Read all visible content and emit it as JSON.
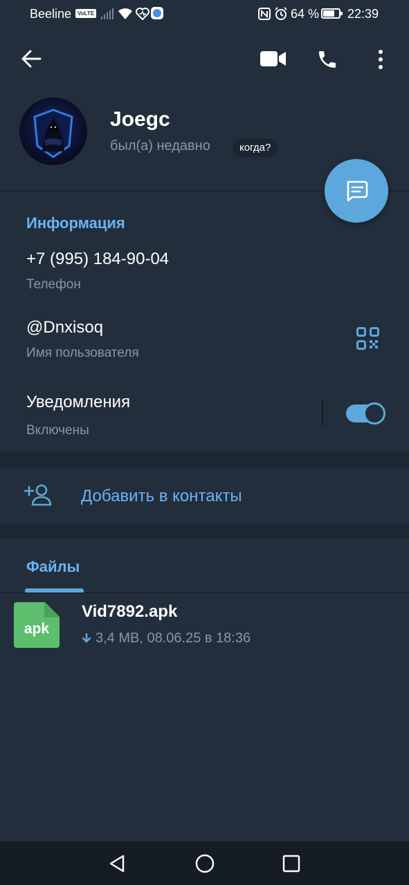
{
  "status_bar": {
    "carrier": "Beeline",
    "volte": "VoLTE",
    "battery": "64 %",
    "time": "22:39"
  },
  "header": {
    "name": "Joegc",
    "status": "был(а) недавно",
    "when_pill": "когда?"
  },
  "info": {
    "title": "Информация",
    "phone": "+7 (995) 184-90-04",
    "phone_label": "Телефон",
    "username": "@Dnxisoq",
    "username_label": "Имя пользователя",
    "notifications": "Уведомления",
    "notifications_state": "Включены",
    "notifications_on": true
  },
  "add_contact": {
    "label": "Добавить в контакты"
  },
  "files": {
    "tab": "Файлы",
    "items": [
      {
        "ext": "apk",
        "name": "Vid7892.apk",
        "meta": "3,4 MB, 08.06.25 в 18:36"
      }
    ]
  },
  "colors": {
    "accent": "#6ab3f3",
    "fab": "#5ca8dc",
    "background": "#1d2733",
    "panel": "#232e3c",
    "file_icon": "#5dbf6d"
  },
  "icons": [
    "back-arrow-icon",
    "video-call-icon",
    "phone-call-icon",
    "more-vert-icon",
    "message-icon",
    "qr-code-icon",
    "add-user-icon",
    "download-arrow-icon",
    "nav-back-icon",
    "nav-home-icon",
    "nav-recents-icon"
  ]
}
